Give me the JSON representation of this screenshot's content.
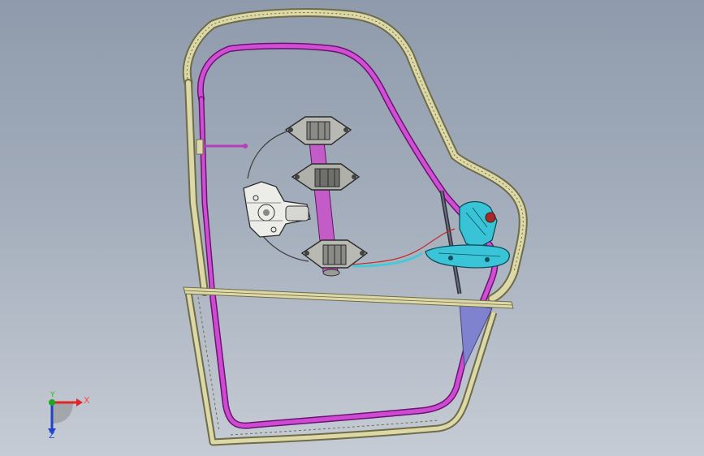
{
  "viewport": {
    "name": "3D model view",
    "background_top": "#8f9bac",
    "background_bottom": "#c6ccd5"
  },
  "model": {
    "parts": [
      "door-frame-outer",
      "window-channel-run",
      "belt-line-beam",
      "lower-door-panel",
      "window-regulator-rail",
      "regulator-mounting-plates",
      "window-motor",
      "regulator-cable",
      "door-latch-assembly",
      "outside-door-handle",
      "rear-glass-guide"
    ],
    "colors": {
      "frame": "#d8d4a2",
      "frame_edge": "#6f6c48",
      "channel": "#c531c8",
      "motor": "#e6e6e2",
      "plate": "#b8b8b4",
      "latch": "#2fc3d9",
      "cable": "#d33838",
      "glass_guide": "#7b7ec9"
    }
  },
  "triad": {
    "x_label": "X",
    "y_label": "Y",
    "z_label": "Z",
    "x_color": "#e02626",
    "y_color": "#1ea81e",
    "z_color": "#2340c9"
  }
}
